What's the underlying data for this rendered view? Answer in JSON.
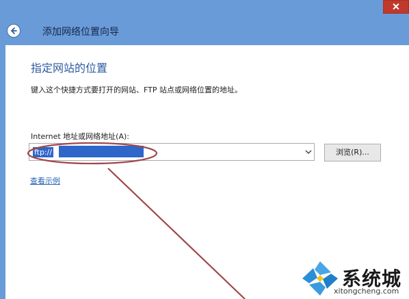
{
  "window": {
    "title": "添加网络位置向导",
    "close_icon": "close-icon",
    "back_icon": "back-arrow-icon"
  },
  "page": {
    "heading": "指定网站的位置",
    "description": "键入这个快捷方式要打开的网站、FTP 站点或网络位置的地址。",
    "field_label": "Internet 地址或网络地址(A):",
    "address_value": "ftp://",
    "browse_label": "浏览(R)...",
    "example_link": "查看示例"
  },
  "watermark": {
    "name": "系统城",
    "url": "xitongcheng.com"
  },
  "colors": {
    "title_bar": "#6a9bd9",
    "heading": "#2c5aa0",
    "link": "#2563b8",
    "selection": "#2f66c9",
    "annotation": "#a0474a",
    "close_button": "#c0392b"
  }
}
